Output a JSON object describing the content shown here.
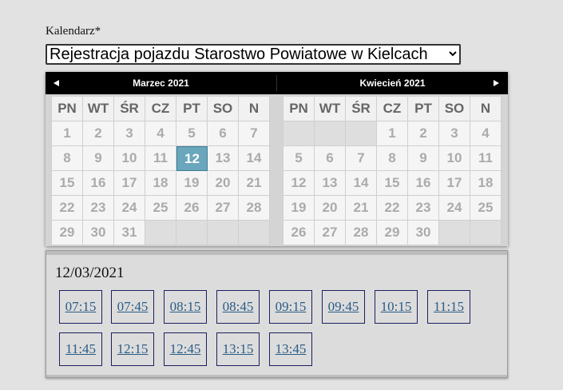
{
  "form": {
    "label": "Kalendarz*",
    "selected_option": "Rejestracja pojazdu Starostwo Powiatowe w Kielcach"
  },
  "calendar": {
    "weekdays": [
      "PN",
      "WT",
      "ŚR",
      "CZ",
      "PT",
      "SO",
      "N"
    ],
    "months": [
      {
        "title": "Marzec 2021",
        "weeks": [
          [
            "1",
            "2",
            "3",
            "4",
            "5",
            "6",
            "7"
          ],
          [
            "8",
            "9",
            "10",
            "11",
            "12",
            "13",
            "14"
          ],
          [
            "15",
            "16",
            "17",
            "18",
            "19",
            "20",
            "21"
          ],
          [
            "22",
            "23",
            "24",
            "25",
            "26",
            "27",
            "28"
          ],
          [
            "29",
            "30",
            "31",
            "",
            "",
            "",
            ""
          ]
        ]
      },
      {
        "title": "Kwiecień 2021",
        "weeks": [
          [
            "",
            "",
            "",
            "1",
            "2",
            "3",
            "4"
          ],
          [
            "5",
            "6",
            "7",
            "8",
            "9",
            "10",
            "11"
          ],
          [
            "12",
            "13",
            "14",
            "15",
            "16",
            "17",
            "18"
          ],
          [
            "19",
            "20",
            "21",
            "22",
            "23",
            "24",
            "25"
          ],
          [
            "26",
            "27",
            "28",
            "29",
            "30",
            "",
            ""
          ]
        ]
      }
    ],
    "selected_day": "12",
    "selected_month_index": 0,
    "colors": {
      "selected": "#6aa6bc",
      "header": "#000000"
    },
    "prev_icon": "triangle-left-icon",
    "next_icon": "triangle-right-icon"
  },
  "slots": {
    "date": "12/03/2021",
    "times": [
      "07:15",
      "07:45",
      "08:15",
      "08:45",
      "09:15",
      "09:45",
      "10:15",
      "11:15",
      "11:45",
      "12:15",
      "12:45",
      "13:15",
      "13:45"
    ],
    "link_color": "#2a5c86"
  }
}
